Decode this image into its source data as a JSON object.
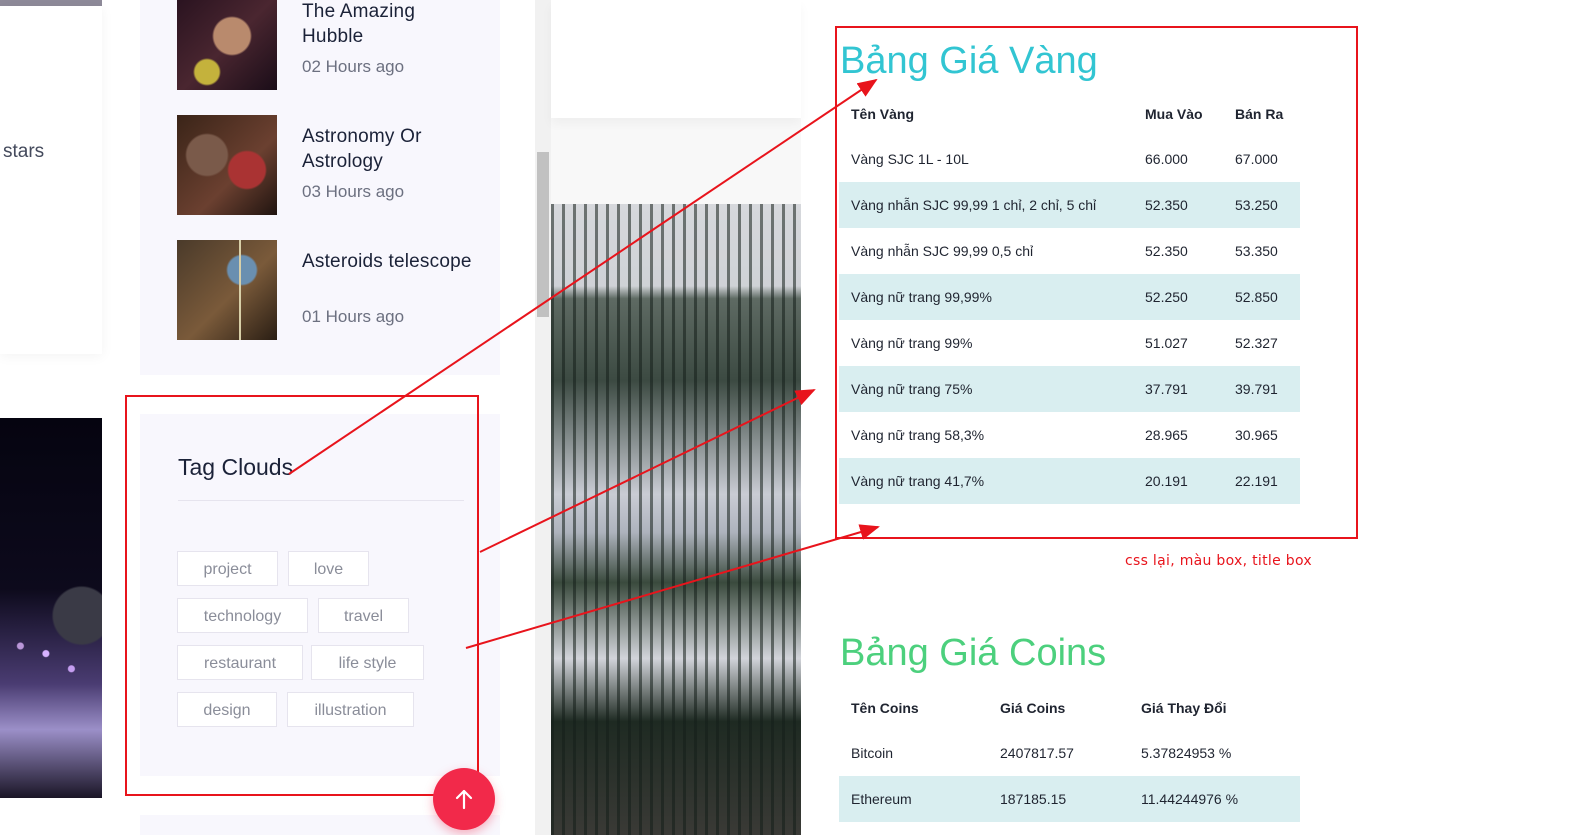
{
  "left_column": {
    "stars_text": "stars"
  },
  "recent_posts": [
    {
      "title": "The Amazing Hubble",
      "time": "02 Hours ago"
    },
    {
      "title": "Astronomy Or Astrology",
      "time": "03 Hours ago"
    },
    {
      "title": "Asteroids telescope",
      "time": "01 Hours ago"
    }
  ],
  "tag_clouds": {
    "heading": "Tag Clouds",
    "tags": [
      "project",
      "love",
      "technology",
      "travel",
      "restaurant",
      "life style",
      "design",
      "illustration"
    ]
  },
  "gold_prices": {
    "title": "Bảng Giá Vàng",
    "title_color": "#32c5d2",
    "headers": [
      "Tên Vàng",
      "Mua Vào",
      "Bán Ra"
    ],
    "rows": [
      [
        "Vàng SJC 1L - 10L",
        "66.000",
        "67.000"
      ],
      [
        "Vàng nhẫn SJC 99,99 1 chỉ, 2 chỉ, 5 chỉ",
        "52.350",
        "53.250"
      ],
      [
        "Vàng nhẫn SJC 99,99 0,5 chỉ",
        "52.350",
        "53.350"
      ],
      [
        "Vàng nữ trang 99,99%",
        "52.250",
        "52.850"
      ],
      [
        "Vàng nữ trang 99%",
        "51.027",
        "52.327"
      ],
      [
        "Vàng nữ trang 75%",
        "37.791",
        "39.791"
      ],
      [
        "Vàng nữ trang 58,3%",
        "28.965",
        "30.965"
      ],
      [
        "Vàng nữ trang 41,7%",
        "20.191",
        "22.191"
      ]
    ]
  },
  "coin_prices": {
    "title": "Bảng Giá Coins",
    "title_color": "#4cd07d",
    "headers": [
      "Tên Coins",
      "Giá Coins",
      "Giá Thay Đổi"
    ],
    "rows": [
      [
        "Bitcoin",
        "2407817.57",
        "5.37824953 %"
      ],
      [
        "Ethereum",
        "187185.15",
        "11.44244976 %"
      ]
    ]
  },
  "annotation": {
    "note": "css lại, màu box, title box",
    "color": "#e8141c"
  },
  "back_to_top": {
    "icon": "arrow-up-icon",
    "color": "#f2294a"
  }
}
